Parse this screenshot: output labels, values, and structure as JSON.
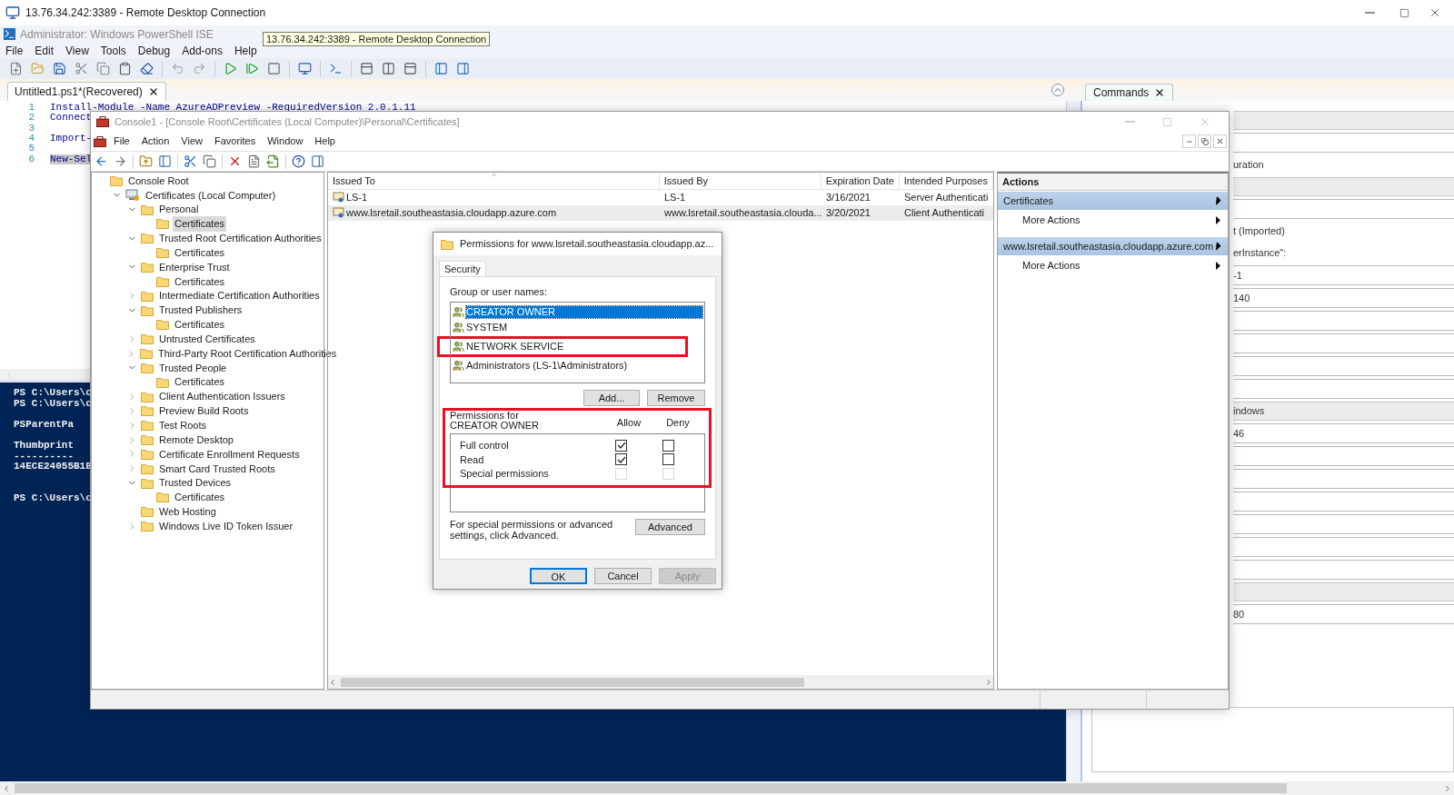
{
  "rdp_window": {
    "title": "13.76.34.242:3389 - Remote Desktop Connection"
  },
  "tooltip": "13.76.34.242:3389 - Remote Desktop Connection",
  "ise": {
    "title": "Administrator: Windows PowerShell ISE",
    "menu": [
      "File",
      "Edit",
      "View",
      "Tools",
      "Debug",
      "Add-ons",
      "Help"
    ],
    "tabs": [
      {
        "label": "Untitled1.ps1*(Recovered)",
        "selected": true
      }
    ],
    "script_lines": [
      {
        "number": "1",
        "text": "Install-Module -Name AzureADPreview -RequiredVersion 2.0.1.11",
        "selected": false
      },
      {
        "number": "2",
        "text": "Connect",
        "selected": false
      },
      {
        "number": "3",
        "selected": false
      },
      {
        "number": "4",
        "text": "Import-",
        "selected": false
      },
      {
        "number": "5",
        "selected": false
      },
      {
        "number": "6",
        "text": "New-Sel",
        "selected": true
      }
    ],
    "console_lines": [
      {
        "kind": "prompt",
        "text": "PS C:\\Users\\c"
      },
      {
        "kind": "prompt",
        "text": "PS C:\\Users\\c"
      },
      {
        "kind": "blank"
      },
      {
        "kind": "output",
        "text": "PSParentPa"
      },
      {
        "kind": "blank"
      },
      {
        "kind": "output",
        "text": "Thumbprint"
      },
      {
        "kind": "output",
        "text": "----------"
      },
      {
        "kind": "output",
        "text": "14ECE24055B1B"
      },
      {
        "kind": "blank"
      },
      {
        "kind": "blank"
      },
      {
        "kind": "prompt",
        "text": "PS C:\\Users\\c"
      }
    ],
    "commands_tab": "Commands",
    "commands_rows": [
      {
        "kind": "band"
      },
      {
        "kind": "field"
      },
      {
        "kind": "label",
        "text": "uration"
      },
      {
        "kind": "band"
      },
      {
        "kind": "field"
      },
      {
        "kind": "label",
        "text": "t (Imported)"
      },
      {
        "kind": "label",
        "text": "erInstance\":"
      },
      {
        "kind": "field",
        "text": "-1"
      },
      {
        "kind": "field",
        "text": "140"
      },
      {
        "kind": "field"
      },
      {
        "kind": "field"
      },
      {
        "kind": "field"
      },
      {
        "kind": "field"
      },
      {
        "kind": "band",
        "text": "indows"
      },
      {
        "kind": "field",
        "text": "46"
      },
      {
        "kind": "field"
      },
      {
        "kind": "field"
      },
      {
        "kind": "field"
      },
      {
        "kind": "field"
      },
      {
        "kind": "field"
      },
      {
        "kind": "field"
      },
      {
        "kind": "band"
      },
      {
        "kind": "field",
        "text": "80"
      }
    ]
  },
  "mmc": {
    "title": "Console1 - [Console Root\\Certificates (Local Computer)\\Personal\\Certificates]",
    "menu": [
      "File",
      "Action",
      "View",
      "Favorites",
      "Window",
      "Help"
    ],
    "tree": [
      {
        "label": "Console Root",
        "kind": "folder",
        "selected": false,
        "children": [
          {
            "label": "Certificates (Local Computer)",
            "kind": "store",
            "expanded": true,
            "selected": false,
            "children": [
              {
                "label": "Personal",
                "kind": "folder",
                "expanded": true,
                "selected": false,
                "children": [
                  {
                    "label": "Certificates",
                    "kind": "folder",
                    "selected": true
                  }
                ]
              },
              {
                "label": "Trusted Root Certification Authorities",
                "kind": "folder",
                "expanded": true,
                "selected": false,
                "children": [
                  {
                    "label": "Certificates",
                    "kind": "folder",
                    "selected": false
                  }
                ]
              },
              {
                "label": "Enterprise Trust",
                "kind": "folder",
                "expanded": true,
                "selected": false,
                "children": [
                  {
                    "label": "Certificates",
                    "kind": "folder",
                    "selected": false
                  }
                ]
              },
              {
                "label": "Intermediate Certification Authorities",
                "kind": "folder",
                "expanded": false,
                "selected": false
              },
              {
                "label": "Trusted Publishers",
                "kind": "folder",
                "expanded": true,
                "selected": false,
                "children": [
                  {
                    "label": "Certificates",
                    "kind": "folder",
                    "selected": false
                  }
                ]
              },
              {
                "label": "Untrusted Certificates",
                "kind": "folder",
                "expanded": false,
                "selected": false
              },
              {
                "label": "Third-Party Root Certification Authorities",
                "kind": "folder",
                "expanded": false,
                "selected": false
              },
              {
                "label": "Trusted People",
                "kind": "folder",
                "expanded": true,
                "selected": false,
                "children": [
                  {
                    "label": "Certificates",
                    "kind": "folder",
                    "selected": false
                  }
                ]
              },
              {
                "label": "Client Authentication Issuers",
                "kind": "folder",
                "expanded": false,
                "selected": false
              },
              {
                "label": "Preview Build Roots",
                "kind": "folder",
                "expanded": false,
                "selected": false
              },
              {
                "label": "Test Roots",
                "kind": "folder",
                "expanded": false,
                "selected": false
              },
              {
                "label": "Remote Desktop",
                "kind": "folder",
                "expanded": false,
                "selected": false
              },
              {
                "label": "Certificate Enrollment Requests",
                "kind": "folder",
                "expanded": false,
                "selected": false
              },
              {
                "label": "Smart Card Trusted Roots",
                "kind": "folder",
                "expanded": false,
                "selected": false
              },
              {
                "label": "Trusted Devices",
                "kind": "folder",
                "expanded": true,
                "selected": false,
                "children": [
                  {
                    "label": "Certificates",
                    "kind": "folder",
                    "selected": false
                  }
                ]
              },
              {
                "label": "Web Hosting",
                "kind": "folder",
                "selected": false
              },
              {
                "label": "Windows Live ID Token Issuer",
                "kind": "folder",
                "expanded": false,
                "selected": false
              }
            ]
          }
        ]
      }
    ],
    "columns": [
      "Issued To",
      "Issued By",
      "Expiration Date",
      "Intended Purposes"
    ],
    "rows": [
      {
        "cells": [
          "LS-1",
          "LS-1",
          "3/16/2021",
          "Server Authenticati"
        ],
        "selected": false
      },
      {
        "cells": [
          "www.lsretail.southeastasia.cloudapp.azure.com",
          "www.lsretail.southeastasia.clouda...",
          "3/20/2021",
          "Client Authenticati"
        ],
        "selected": true
      }
    ],
    "actions": {
      "title": "Actions",
      "sections": [
        {
          "title": "Certificates",
          "items": [
            "More Actions"
          ]
        },
        {
          "title": "www.lsretail.southeastasia.cloudapp.azure.com",
          "items": [
            "More Actions"
          ]
        }
      ]
    }
  },
  "dialog": {
    "title": "Permissions for www.lsretail.southeastasia.cloudapp.az...",
    "tabs": [
      {
        "label": "Security",
        "selected": true
      }
    ],
    "group_label": "Group or user names:",
    "principals": [
      {
        "name": "CREATOR OWNER",
        "selected": true,
        "highlighted": false
      },
      {
        "name": "SYSTEM",
        "selected": false,
        "highlighted": false
      },
      {
        "name": "NETWORK SERVICE",
        "selected": false,
        "highlighted": true
      },
      {
        "name": "Administrators (LS-1\\Administrators)",
        "selected": false,
        "highlighted": false
      }
    ],
    "add_button": "Add...",
    "remove_button": "Remove",
    "permissions_label": "Permissions for CREATOR OWNER",
    "permissions_highlighted": true,
    "allow_header": "Allow",
    "deny_header": "Deny",
    "permissions": [
      {
        "name": "Full control",
        "allow": true,
        "deny": false,
        "disabled": false
      },
      {
        "name": "Read",
        "allow": true,
        "deny": false,
        "disabled": false
      },
      {
        "name": "Special permissions",
        "allow": false,
        "deny": false,
        "disabled": true
      }
    ],
    "advanced_note": "For special permissions or advanced settings, click Advanced.",
    "advanced_button": "Advanced",
    "buttons": [
      {
        "label": "OK",
        "kind": "default"
      },
      {
        "label": "Cancel",
        "kind": "normal"
      },
      {
        "label": "Apply",
        "kind": "disabled"
      }
    ]
  }
}
